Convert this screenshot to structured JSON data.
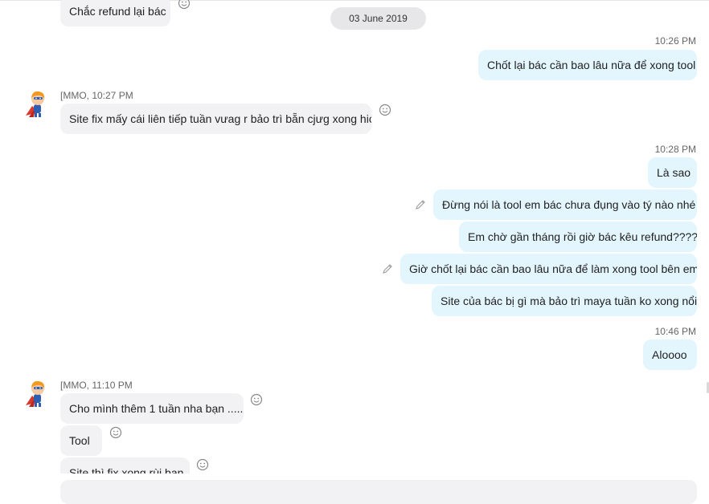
{
  "date_separator": "03 June 2019",
  "messages": {
    "m0": "Chắc refund lại bác",
    "t1": "10:26 PM",
    "m1": "Chốt lại bác cần bao lâu nữa để xong tool",
    "s2": "[MMO, 10:27 PM",
    "m2": "Site fix mấy cái liên tiếp tuần vưag r bảo trì bẵn cjưg xong hic",
    "t3": "10:28 PM",
    "m3": "Là sao",
    "m4": "Đừng nói là tool em bác chưa đụng vào tý nào nhé",
    "m5": "Em chờ gần tháng rồi giờ bác kêu refund????",
    "m6": "Giờ chốt lại bác cần bao lâu nữa để làm xong tool bên em",
    "m7": "Site của bác bị gì mà bảo trì maya tuần ko xong nổi",
    "t8": "10:46 PM",
    "m8": "Aloooo",
    "s9": "[MMO, 11:10 PM",
    "m9": "Cho mình thêm 1 tuần nha bạn .....",
    "m10": "Tool",
    "m11": "Site thì fix xong rùi bạn"
  },
  "icons": {
    "emoji": "smiley-icon",
    "edit": "pencil-icon",
    "avatar": "superhero-avatar"
  },
  "colors": {
    "incoming_bubble": "#f2f2f4",
    "outgoing_bubble": "#e3f5fd",
    "date_pill": "#e7e7ea"
  }
}
